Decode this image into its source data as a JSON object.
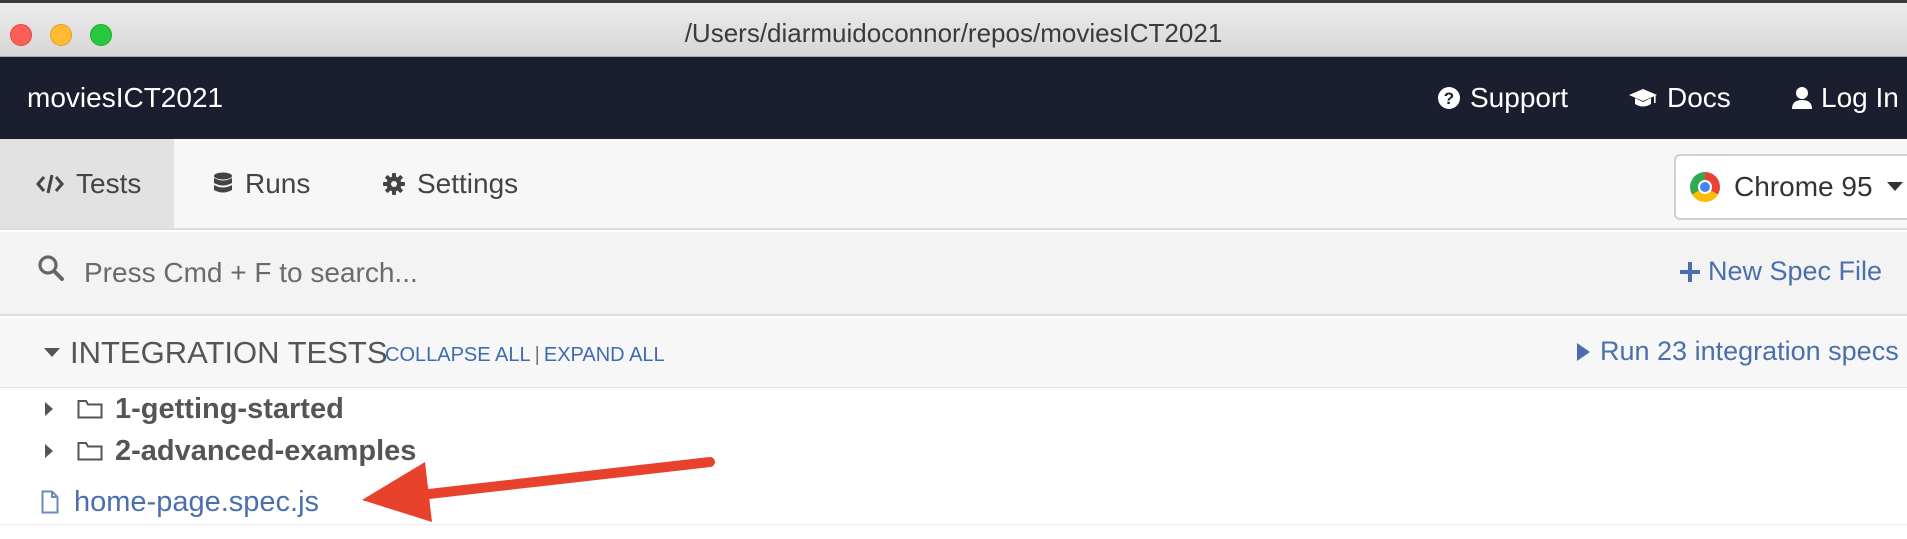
{
  "window": {
    "title": "/Users/diarmuidoconnor/repos/moviesICT2021"
  },
  "appbar": {
    "project_name": "moviesICT2021",
    "nav": {
      "support": "Support",
      "docs": "Docs",
      "login": "Log In"
    }
  },
  "tabs": {
    "tests": "Tests",
    "runs": "Runs",
    "settings": "Settings",
    "active": "tests"
  },
  "browser": {
    "selected": "Chrome 95"
  },
  "search": {
    "placeholder": "Press Cmd + F to search...",
    "value": ""
  },
  "new_spec_label": "New Spec File",
  "integration": {
    "title": "INTEGRATION TESTS",
    "collapse_all": "COLLAPSE ALL",
    "separator": "|",
    "expand_all": "EXPAND ALL",
    "run_label": "Run 23 integration specs"
  },
  "spec_list": {
    "folders": [
      "1-getting-started",
      "2-advanced-examples"
    ],
    "files": [
      "home-page.spec.js"
    ]
  },
  "colors": {
    "header_bg": "#1b1e2e",
    "link": "#4b6fae",
    "annotation_arrow": "#e8412c"
  }
}
